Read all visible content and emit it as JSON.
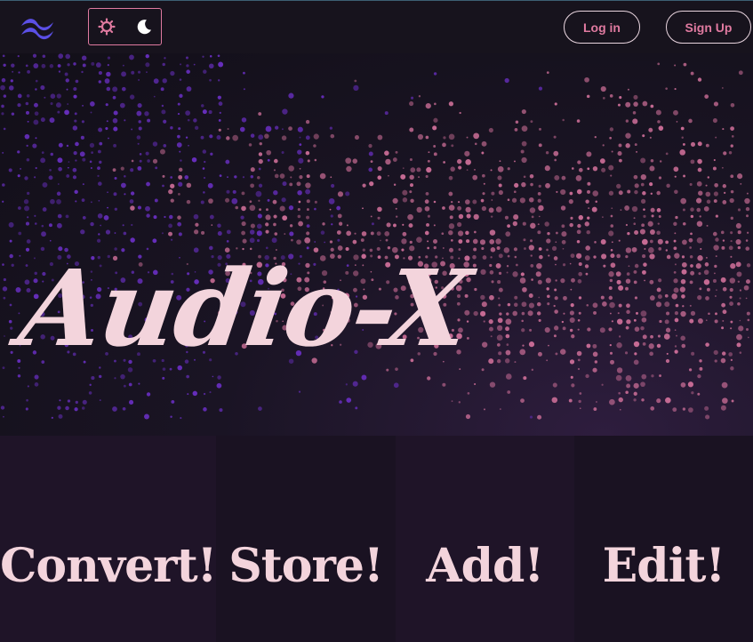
{
  "navbar": {
    "logo_icon": "tailwind-wave-icon",
    "theme_toggle": {
      "light_icon": "sun-icon",
      "dark_icon": "moon-icon"
    },
    "login_label": "Log in",
    "signup_label": "Sign Up"
  },
  "hero": {
    "title": "Audio-X",
    "background": "sound-wave-dots-visualization"
  },
  "features": [
    {
      "label": "Convert!"
    },
    {
      "label": "Store!"
    },
    {
      "label": "Add!"
    },
    {
      "label": "Edit!"
    }
  ],
  "colors": {
    "accent_pink": "#e07aa0",
    "title_pink": "#f3d4dc",
    "dot_purple": "#6a2fc4",
    "dot_pink": "#d0709a",
    "background": "#15111c"
  }
}
